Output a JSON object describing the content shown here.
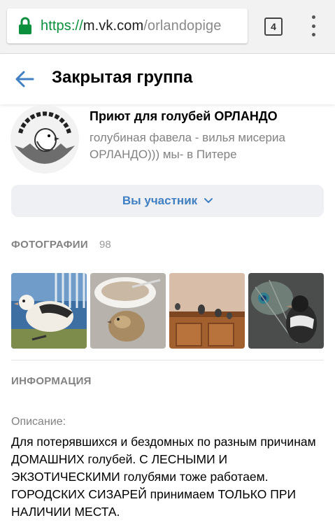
{
  "browser": {
    "url_scheme": "https://",
    "url_host": "m.vk.com",
    "url_path": "/orlandopige",
    "tab_count": "4"
  },
  "header": {
    "title": "Закрытая группа"
  },
  "group": {
    "name": "Приют для голубей ОРЛАНДО",
    "status": "голубиная фавела - вилья мисериа ОРЛАНДО))) мы- в Питере",
    "avatar_icon": "orlando-pigeon-logo"
  },
  "member_button": {
    "label": "Вы участник"
  },
  "photos": {
    "title": "ФОТОГРАФИИ",
    "count": "98"
  },
  "info": {
    "title": "ИНФОРМАЦИЯ",
    "description_label": "Описание:",
    "description": "Для потерявшихся и бездомных по разным причинам ДОМАШНИХ голубей. С ЛЕСНЫМИ И ЭКЗОТИЧЕСКИМИ голубями тоже работаем. ГОРОДСКИХ СИЗАРЕЙ принимаем ТОЛЬКО ПРИ НАЛИЧИИ МЕСТА."
  },
  "colors": {
    "accent": "#3f7fc2",
    "secure": "#0a8f3c",
    "muted": "#828282"
  }
}
